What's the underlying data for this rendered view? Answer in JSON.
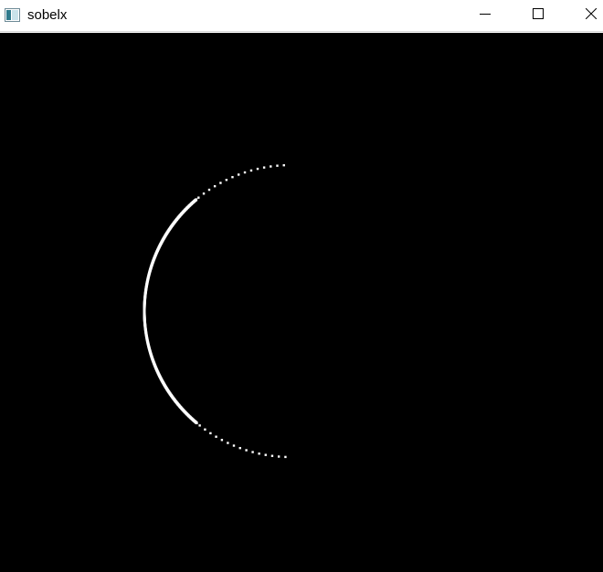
{
  "window": {
    "title": "sobelx",
    "icons": {
      "app": "app-window-icon",
      "minimize": "minimize-icon",
      "maximize": "maximize-icon",
      "close": "close-icon"
    }
  },
  "canvas": {
    "background": "#000000",
    "edge_color": "#ffffff"
  }
}
